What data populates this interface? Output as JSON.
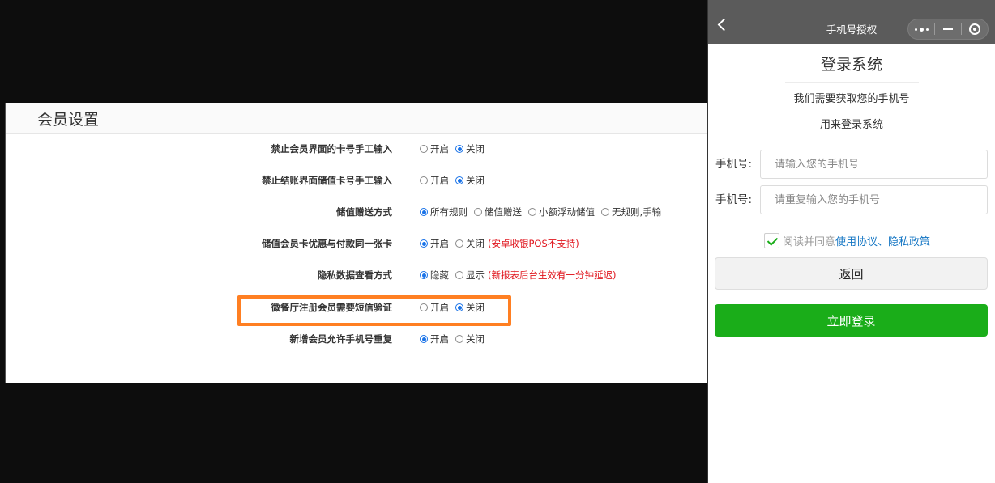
{
  "settings": {
    "title": "会员设置",
    "rows": [
      {
        "label": "禁止会员界面的卡号手工输入",
        "options": [
          {
            "label": "开启",
            "checked": false
          },
          {
            "label": "关闭",
            "checked": true
          }
        ],
        "note": ""
      },
      {
        "label": "禁止结账界面储值卡号手工输入",
        "options": [
          {
            "label": "开启",
            "checked": false
          },
          {
            "label": "关闭",
            "checked": true
          }
        ],
        "note": ""
      },
      {
        "label": "储值赠送方式",
        "options": [
          {
            "label": "所有规则",
            "checked": true
          },
          {
            "label": "储值赠送",
            "checked": false
          },
          {
            "label": "小额浮动储值",
            "checked": false
          },
          {
            "label": "无规则,手输",
            "checked": false
          }
        ],
        "note": ""
      },
      {
        "label": "储值会员卡优惠与付款同一张卡",
        "options": [
          {
            "label": "开启",
            "checked": true
          },
          {
            "label": "关闭",
            "checked": false
          }
        ],
        "note": "(安卓收银POS不支持)"
      },
      {
        "label": "隐私数据查看方式",
        "options": [
          {
            "label": "隐藏",
            "checked": true
          },
          {
            "label": "显示",
            "checked": false
          }
        ],
        "note": "(新报表后台生效有一分钟延迟)"
      },
      {
        "label": "微餐厅注册会员需要短信验证",
        "options": [
          {
            "label": "开启",
            "checked": false
          },
          {
            "label": "关闭",
            "checked": true
          }
        ],
        "note": ""
      },
      {
        "label": "新增会员允许手机号重复",
        "options": [
          {
            "label": "开启",
            "checked": true
          },
          {
            "label": "关闭",
            "checked": false
          }
        ],
        "note": ""
      }
    ]
  },
  "phone": {
    "nav_title": "手机号授权",
    "login_title": "登录系统",
    "desc_line1": "我们需要获取您的手机号",
    "desc_line2": "用来登录系统",
    "phone_label": "手机号:",
    "phone_placeholder": "请输入您的手机号",
    "repeat_label": "手机号:",
    "repeat_placeholder": "请重复输入您的手机号",
    "agree_text": "阅读并同意",
    "agree_link": "使用协议、隐私政策",
    "agree_checked": true,
    "back_label": "返回",
    "login_label": "立即登录"
  },
  "colors": {
    "highlight": "#ff7f22",
    "primary_green": "#1aad19",
    "radio_blue": "#1a73e8",
    "warning_red": "#e0141c",
    "link_blue": "#1677c4"
  },
  "icons": {
    "back": "back-arrow-icon",
    "more": "more-dots-icon",
    "minimize": "minimize-icon",
    "close": "close-target-icon"
  }
}
